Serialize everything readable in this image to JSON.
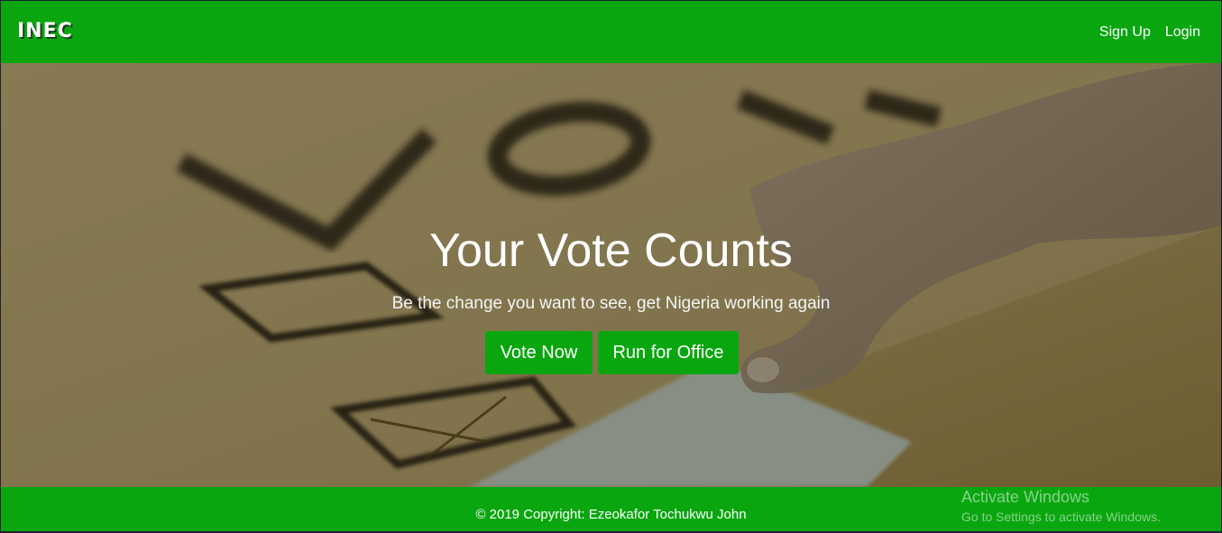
{
  "navbar": {
    "brand": "INEC",
    "links": [
      "Sign Up",
      "Login"
    ]
  },
  "hero": {
    "title": "Your Vote Counts",
    "subtitle": "Be the change you want to see, get Nigeria working again",
    "buttons": {
      "vote": "Vote Now",
      "run": "Run for Office"
    }
  },
  "footer": {
    "copyright": "© 2019 Copyright: Ezeokafor Tochukwu John"
  },
  "watermark": {
    "title": "Activate Windows",
    "subtitle": "Go to Settings to activate Windows."
  },
  "colors": {
    "brand_green": "#0aa60f",
    "text": "#ffffff"
  }
}
